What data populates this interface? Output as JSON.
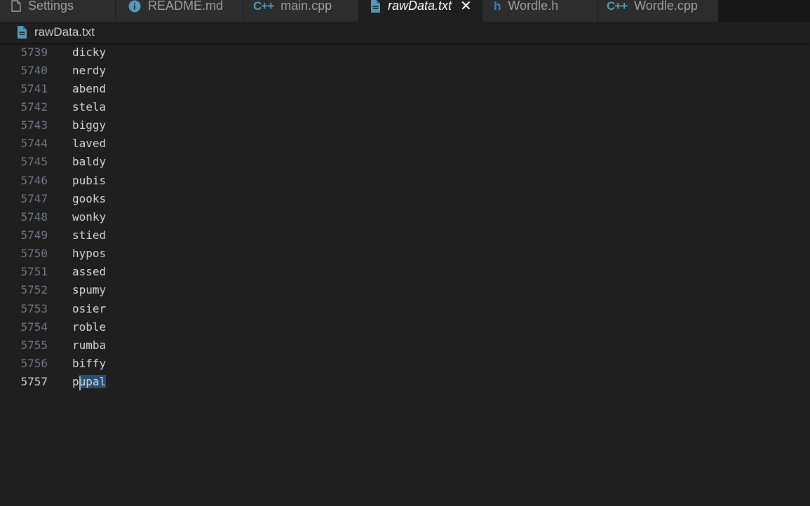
{
  "tabs": [
    {
      "label": "Settings",
      "icon": "settings-file-icon",
      "active": false
    },
    {
      "label": "README.md",
      "icon": "info-icon",
      "active": false
    },
    {
      "label": "main.cpp",
      "icon": "cpp-icon",
      "active": false
    },
    {
      "label": "rawData.txt",
      "icon": "text-file-icon",
      "active": true,
      "close": "✕"
    },
    {
      "label": "Wordle.h",
      "icon": "h-icon",
      "active": false
    },
    {
      "label": "Wordle.cpp",
      "icon": "cpp-icon",
      "active": false
    }
  ],
  "breadcrumb": {
    "file": "rawData.txt",
    "icon": "text-file-icon"
  },
  "editor": {
    "lines": [
      {
        "num": "5739",
        "text": "dicky"
      },
      {
        "num": "5740",
        "text": "nerdy"
      },
      {
        "num": "5741",
        "text": "abend"
      },
      {
        "num": "5742",
        "text": "stela"
      },
      {
        "num": "5743",
        "text": "biggy"
      },
      {
        "num": "5744",
        "text": "laved"
      },
      {
        "num": "5745",
        "text": "baldy"
      },
      {
        "num": "5746",
        "text": "pubis"
      },
      {
        "num": "5747",
        "text": "gooks"
      },
      {
        "num": "5748",
        "text": "wonky"
      },
      {
        "num": "5749",
        "text": "stied"
      },
      {
        "num": "5750",
        "text": "hypos"
      },
      {
        "num": "5751",
        "text": "assed"
      },
      {
        "num": "5752",
        "text": "spumy"
      },
      {
        "num": "5753",
        "text": "osier"
      },
      {
        "num": "5754",
        "text": "roble"
      },
      {
        "num": "5755",
        "text": "rumba"
      },
      {
        "num": "5756",
        "text": "biffy"
      }
    ],
    "current_line": {
      "num": "5757",
      "before": "p",
      "selected": "upal"
    }
  },
  "colors": {
    "background": "#1f1f1f",
    "tabbar": "#181818",
    "inactive_tab": "#2d2d2d",
    "selection": "#264f78",
    "accent_blue": "#519aba"
  }
}
